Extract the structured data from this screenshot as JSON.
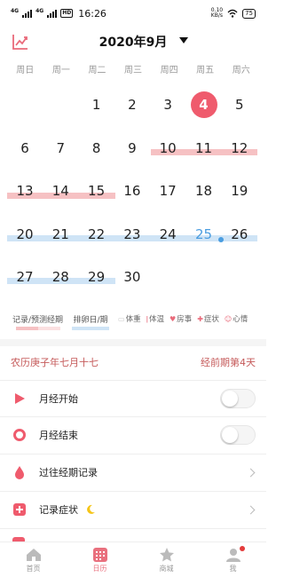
{
  "status_bar": {
    "time": "16:26",
    "network_tags": [
      "4G",
      "4G"
    ],
    "hd_badge": "HD",
    "speed_value": "0.10",
    "speed_unit": "KB/s",
    "battery": "75"
  },
  "header": {
    "title": "2020年9月"
  },
  "weekdays": [
    "周日",
    "周一",
    "周二",
    "周三",
    "周四",
    "周五",
    "周六"
  ],
  "calendar": {
    "today": 4,
    "ovulation_day": 25,
    "rows": [
      [
        "",
        "",
        "1",
        "2",
        "3",
        "4",
        "5"
      ],
      [
        "6",
        "7",
        "8",
        "9",
        "10",
        "11",
        "12"
      ],
      [
        "13",
        "14",
        "15",
        "16",
        "17",
        "18",
        "19"
      ],
      [
        "20",
        "21",
        "22",
        "23",
        "24",
        "25",
        "26"
      ],
      [
        "27",
        "28",
        "29",
        "30",
        "",
        "",
        ""
      ]
    ]
  },
  "legend": {
    "period_label": "记录/预测经期",
    "ovulation_label": "排卵日/期",
    "items": [
      {
        "icon": "weight-icon",
        "label": "体重"
      },
      {
        "icon": "thermometer-icon",
        "label": "体温"
      },
      {
        "icon": "heart-icon",
        "label": "房事"
      },
      {
        "icon": "plus-icon",
        "label": "症状"
      },
      {
        "icon": "mood-icon",
        "label": "心情"
      }
    ]
  },
  "info": {
    "lunar_date": "农历庚子年七月十七",
    "cycle_status": "经前期第4天"
  },
  "settings": [
    {
      "label": "月经开始",
      "control": "toggle",
      "on": false
    },
    {
      "label": "月经结束",
      "control": "toggle",
      "on": false
    },
    {
      "label": "过往经期记录",
      "control": "chevron"
    },
    {
      "label": "记录症状",
      "control": "chevron"
    }
  ],
  "bottom_nav": [
    {
      "label": "首页",
      "active": false
    },
    {
      "label": "日历",
      "active": true
    },
    {
      "label": "商城",
      "active": false
    },
    {
      "label": "我",
      "active": false,
      "badge": true
    }
  ],
  "colors": {
    "accent": "#ef5b6d",
    "period_band": "#f6c1c3",
    "ovulation_band": "#cfe4f6",
    "ovulation_text": "#4a9de0"
  }
}
